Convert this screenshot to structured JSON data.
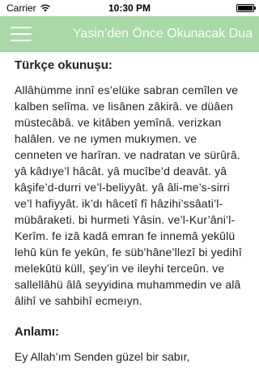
{
  "status_bar": {
    "carrier": "Carrier",
    "time": "10:30 PM",
    "battery_level": 1.0
  },
  "nav": {
    "title": "Yasin’den Önce Okunacak Dua",
    "menu_icon": "hamburger-menu-icon",
    "background_color": "#a8d9a6"
  },
  "content": {
    "turkish_heading": "Türkçe okunuşu:",
    "turkish_text": "Allâhümme innî es’elüke sabran cemîlen ve kalben selîma. ve lisânen zâkirâ. ve düâen müstecâbâ. ve kitâben yemînâ. verizkan halâlen. ve ne ıymen mukıymen. ve cenneten ve harîran. ve nadratan ve sürûrâ. yâ kâdıye’l hâcât. yâ mucîbe’d deavât. yâ kâşife’d-durri ve’l-beliyyât. yâ âli-me’s-sirri ve’l hafiyyât. ik’dı hâcetî fî hâzihi’ssâati’l-mübâraketi. bi hurmeti Yâsin. ve’l-Kur’âni’l-Kerîm. fe izâ kadâ emran fe innemâ yekûlü lehû kün fe yekûn, fe süb’hâne’llezî bi yedihî melekûtü küll, şey’in ve ileyhi terceûn. ve sallellâhü âlâ seyyidina muhammedin ve alâ âlihî ve sahbihî ecmeıyn.",
    "meaning_heading": "Anlamı:",
    "meaning_text": "Ey Allah’ım Senden güzel bir sabır,"
  }
}
